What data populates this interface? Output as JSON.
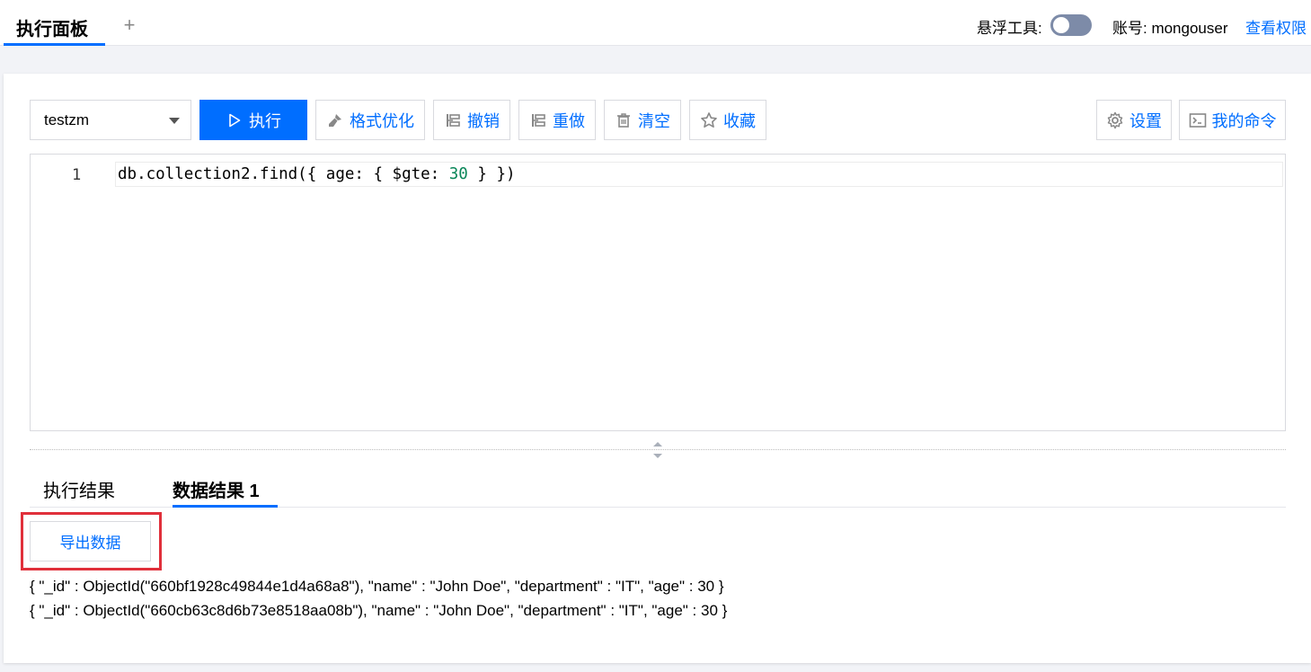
{
  "topbar": {
    "active_tab": "执行面板",
    "add_tab_glyph": "+",
    "float_tool_label": "悬浮工具:",
    "float_tool_on": false,
    "account": "账号: mongouser",
    "view_permissions": "查看权限"
  },
  "toolbar": {
    "database": "testzm",
    "run": "执行",
    "format": "格式优化",
    "undo": "撤销",
    "redo": "重做",
    "clear": "清空",
    "favorite": "收藏",
    "settings": "设置",
    "my_commands": "我的命令"
  },
  "editor": {
    "line_number": "1",
    "code_before": "db.collection2.find({ age: { $gte: ",
    "code_number": "30",
    "code_after": " } })"
  },
  "results": {
    "tabs": [
      "执行结果",
      "数据结果 1"
    ],
    "active_tab_index": 1,
    "export_button": "导出数据",
    "documents": [
      "{ \"_id\" : ObjectId(\"660bf1928c49844e1d4a68a8\"), \"name\" : \"John Doe\", \"department\" : \"IT\", \"age\" : 30 }",
      "{ \"_id\" : ObjectId(\"660cb63c8d6b73e8518aa08b\"), \"name\" : \"John Doe\", \"department\" : \"IT\", \"age\" : 30 }"
    ]
  },
  "colors": {
    "accent": "#006eff",
    "highlight_outline": "#e0303b",
    "toggle_off": "#7d8ba8",
    "number_literal": "#098658"
  }
}
